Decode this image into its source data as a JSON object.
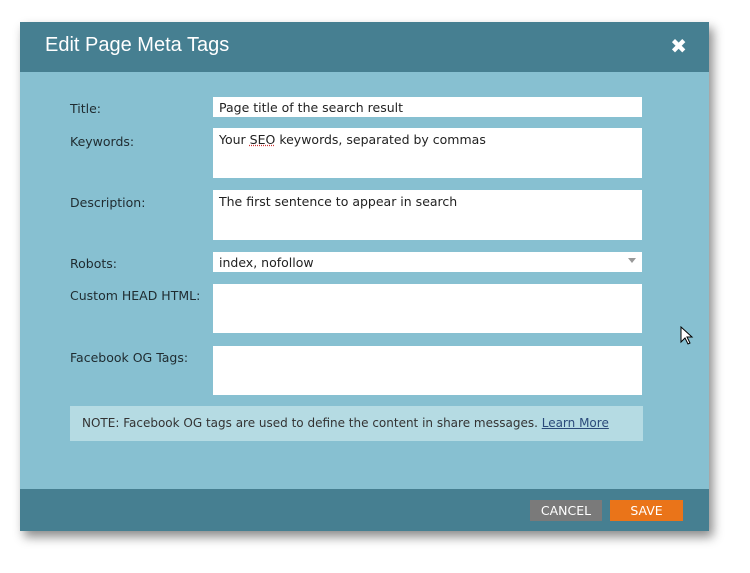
{
  "dialog": {
    "title": "Edit Page Meta Tags",
    "close_icon": "close-icon"
  },
  "fields": {
    "title": {
      "label": "Title:",
      "value": "Page title of the search result"
    },
    "keywords": {
      "label": "Keywords:",
      "value_pre": "Your ",
      "value_seo": "SEO",
      "value_post": " keywords, separated by commas"
    },
    "description": {
      "label": "Description:",
      "value": "The first sentence to appear in search"
    },
    "robots": {
      "label": "Robots:",
      "value": "index, nofollow"
    },
    "custom_head": {
      "label": "Custom HEAD HTML:",
      "value": ""
    },
    "facebook_og": {
      "label": "Facebook OG Tags:",
      "value": ""
    }
  },
  "note": {
    "text": "NOTE:  Facebook OG tags are used to define the content in share messages. ",
    "link": "Learn More"
  },
  "footer": {
    "cancel": "CANCEL",
    "save": "SAVE"
  },
  "colors": {
    "header": "#467f91",
    "body": "#87c0d1",
    "save": "#ea7419",
    "cancel": "#7a7a7a"
  }
}
